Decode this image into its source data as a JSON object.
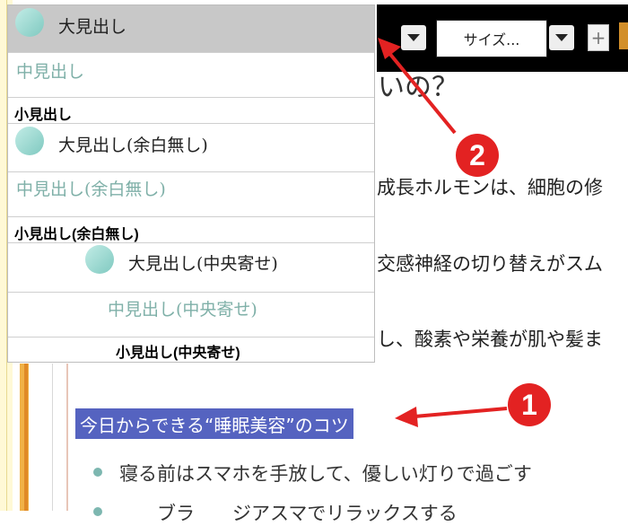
{
  "toolbar": {
    "size_select": "サイズ..."
  },
  "article": {
    "title_fragment": "いの？",
    "paragraphs": [
      "成長ホルモンは、細胞の修",
      "交感神経の切り替えがスム",
      "し、酸素や栄養が肌や髪ま"
    ],
    "selected_heading": "今日からできる“睡眠美容”のコツ",
    "list_items": [
      "寝る前はスマホを手放して、優しい灯りで過ごす",
      "　　ブラ　　ジアスマでリラックスする"
    ]
  },
  "style_menu": {
    "items": [
      {
        "label": "大見出し",
        "style": "big"
      },
      {
        "label": "中見出し",
        "style": "mid"
      },
      {
        "label": "小見出し",
        "style": "small"
      },
      {
        "label": "大見出し(余白無し)",
        "style": "big"
      },
      {
        "label": "中見出し(余白無し)",
        "style": "mid"
      },
      {
        "label": "小見出し(余白無し)",
        "style": "small"
      },
      {
        "label": "大見出し(中央寄せ)",
        "style": "big"
      },
      {
        "label": "中見出し(中央寄せ)",
        "style": "mid"
      },
      {
        "label": "小見出し(中央寄せ)",
        "style": "small"
      }
    ]
  },
  "annotations": {
    "badge1": "1",
    "badge2": "2"
  },
  "colors": {
    "accent_red": "#e32222",
    "selection": "#5563c0",
    "heading_teal": "#7fb0a8",
    "toolbar_black": "#000000"
  }
}
